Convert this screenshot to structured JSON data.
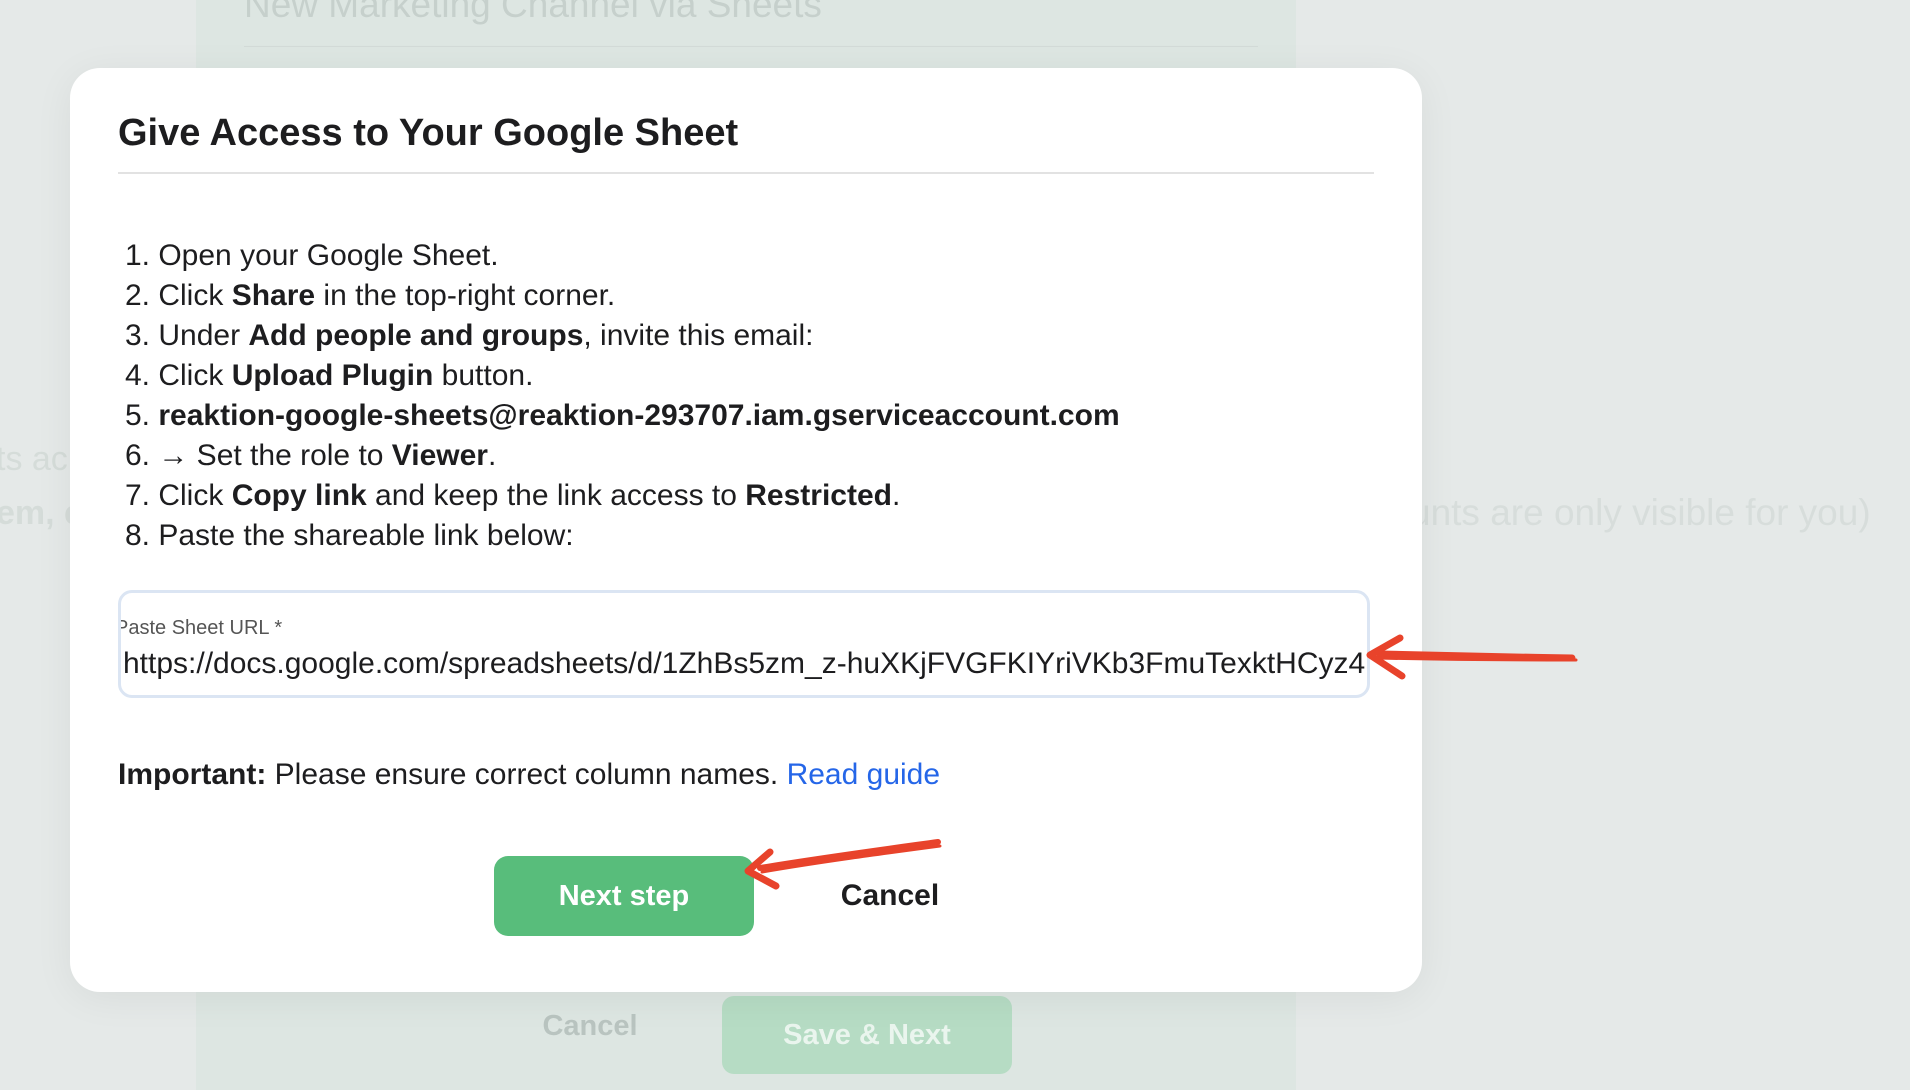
{
  "background": {
    "title": "New Marketing Channel via Sheets",
    "left_text_1": "ts ac",
    "left_text_2": "em, c",
    "right_note": "unts are only visible for you)",
    "cancel_label": "Cancel",
    "save_next_label": "Save & Next"
  },
  "modal": {
    "title": "Give Access to Your Google Sheet",
    "steps": [
      {
        "num": "1.",
        "parts": [
          "Open your Google Sheet."
        ]
      },
      {
        "num": "2.",
        "pre": "Click ",
        "bold": "Share",
        "post": " in the top-right corner."
      },
      {
        "num": "3.",
        "pre": "Under ",
        "bold": "Add people and groups",
        "post": ", invite this email:"
      },
      {
        "num": "4.",
        "pre": "Click ",
        "bold": "Upload Plugin",
        "post": " button."
      },
      {
        "num": "5.",
        "bold": "reaktion-google-sheets@reaktion-293707.iam.gserviceaccount.com"
      },
      {
        "num": "6.",
        "pre": "→ Set the role to ",
        "bold": "Viewer",
        "post": "."
      },
      {
        "num": "7.",
        "pre": "Click ",
        "bold": "Copy link",
        "post": " and keep the link access to ",
        "bold2": "Restricted",
        "post2": "."
      },
      {
        "num": "8.",
        "pre": "Paste the shareable link below:"
      }
    ],
    "url_field": {
      "label": "Paste Sheet URL *",
      "value": "https://docs.google.com/spreadsheets/d/1ZhBs5zm_z-huXKjFVGFKIYriVKb3FmuTexktHCyz4"
    },
    "important": {
      "label": "Important:",
      "text": " Please ensure correct column names. ",
      "link": "Read guide"
    },
    "buttons": {
      "next": "Next step",
      "cancel": "Cancel"
    }
  },
  "colors": {
    "primary_button": "#58bd7b",
    "link": "#2566e8",
    "annotation_arrow": "#e8432b"
  }
}
